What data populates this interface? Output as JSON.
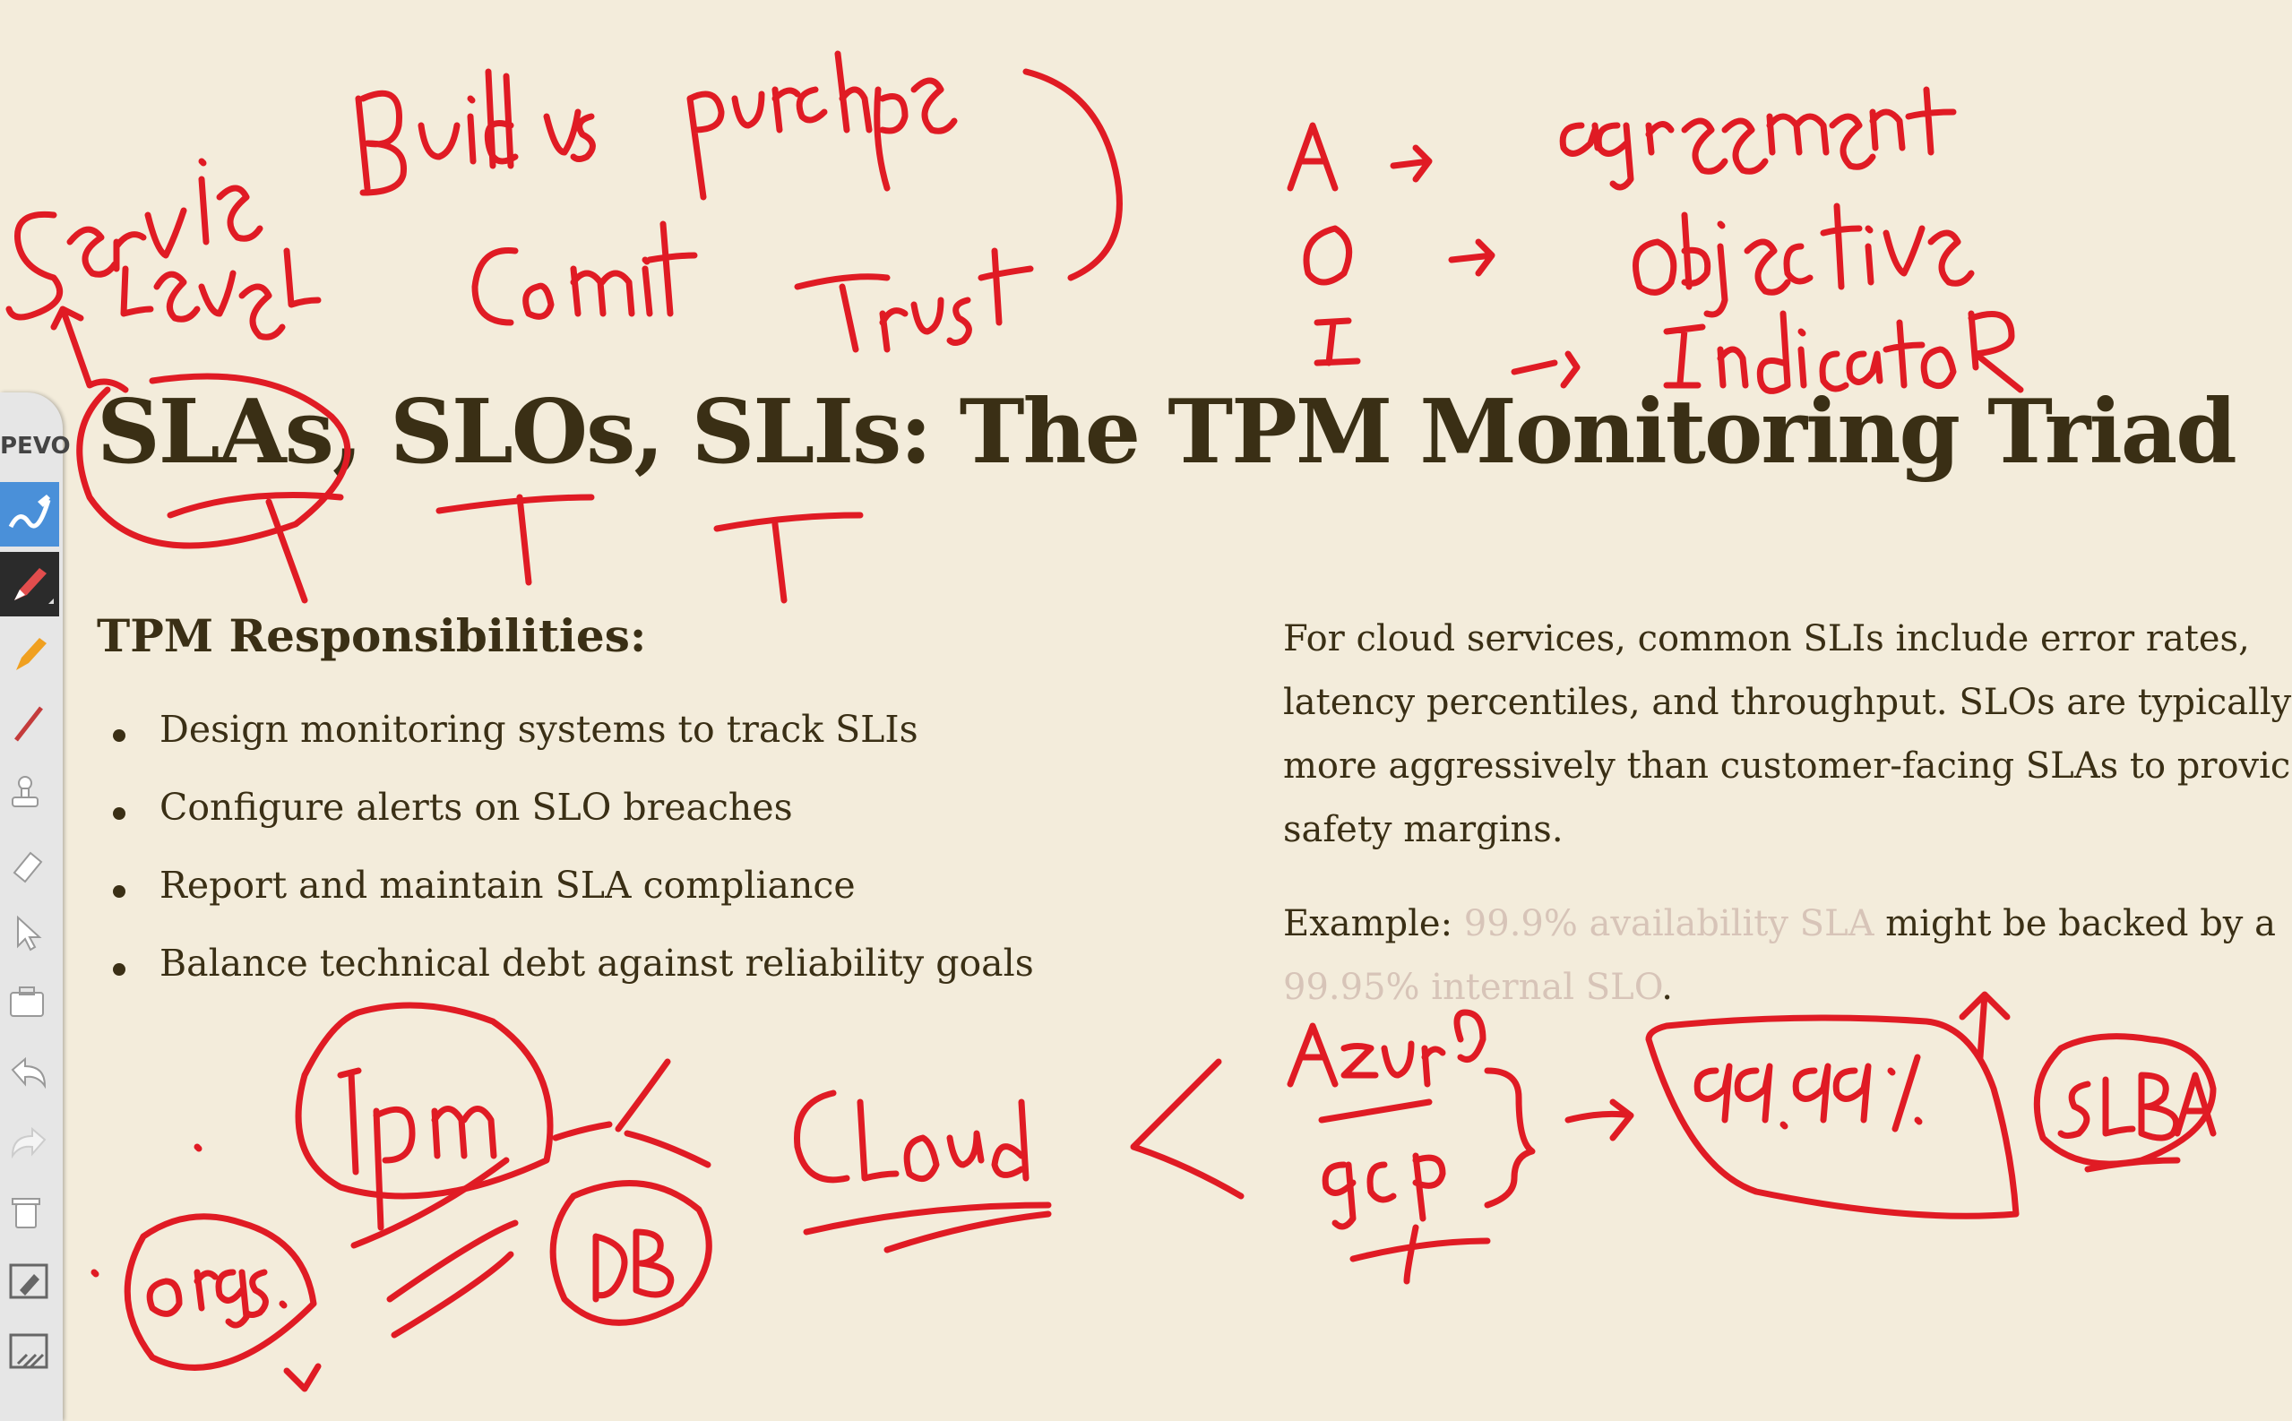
{
  "slide": {
    "title": "SLAs, SLOs, SLIs: The TPM Monitoring Triad",
    "responsibilities_heading": "TPM Responsibilities:",
    "responsibilities": [
      "Design monitoring systems to track SLIs",
      "Configure alerts on SLO breaches",
      "Report and maintain SLA compliance",
      "Balance technical debt against reliability goals"
    ],
    "paragraph_lines": [
      "For cloud services, common SLIs include error rates,",
      "latency percentiles, and throughput. SLOs are typically",
      "more aggressively than customer-facing SLAs to provic",
      "safety margins."
    ],
    "example_label": "Example: ",
    "example_faded_1": "99.9% availability SLA",
    "example_mid": " might be backed by a",
    "example_faded_2": "99.95% internal SLO",
    "example_end": "."
  },
  "toolbar": {
    "brand": "PEVO",
    "tools": [
      {
        "icon": "marker-icon",
        "state": "active"
      },
      {
        "icon": "pen-icon",
        "state": "selected"
      },
      {
        "icon": "highlighter-icon"
      },
      {
        "icon": "line-icon"
      },
      {
        "icon": "stamp-icon"
      },
      {
        "icon": "eraser-icon"
      },
      {
        "icon": "pointer-icon"
      },
      {
        "icon": "toolbox-icon"
      },
      {
        "icon": "undo-icon"
      },
      {
        "icon": "redo-icon"
      },
      {
        "icon": "trash-icon"
      },
      {
        "icon": "whiteboard-icon"
      },
      {
        "icon": "screen-draw-icon"
      }
    ]
  },
  "annotations": {
    "ink_color": "#e01b24",
    "handwriting": [
      "Service",
      "Level",
      "Build vs purchase",
      "Commit",
      "Trust",
      "A",
      "O",
      "I",
      "agreement",
      "Objective",
      "Indicator",
      "Tpm",
      "Orgs.",
      "DB",
      "Cloud",
      "Azure",
      "gcp",
      "99.99%",
      "SLA"
    ]
  },
  "colors": {
    "background": "#f3ecdb",
    "text": "#3a2f15",
    "faded_text": "#d7c4b8",
    "toolbar": "#e6e6e6",
    "toolbar_active": "#4a90d9"
  }
}
